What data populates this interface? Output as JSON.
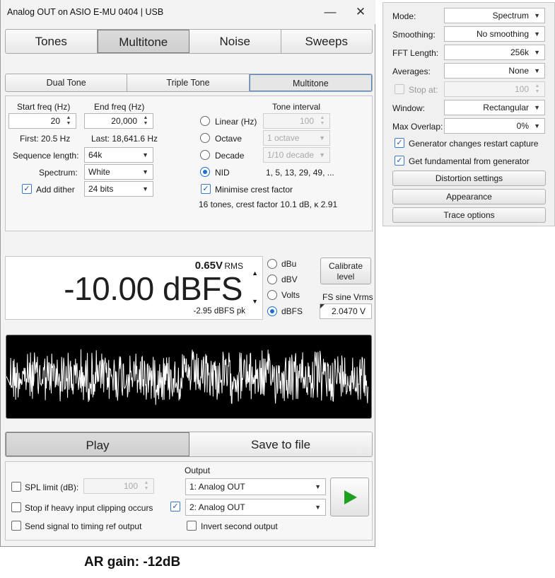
{
  "window": {
    "title": "Analog OUT on ASIO E-MU 0404 | USB",
    "minimize": "—",
    "close": "✕"
  },
  "main_tabs": [
    "Tones",
    "Multitone",
    "Noise",
    "Sweeps"
  ],
  "main_tab_selected": "Multitone",
  "sub_tabs": [
    "Dual Tone",
    "Triple Tone",
    "Multitone"
  ],
  "sub_tab_selected": "Multitone",
  "multitone": {
    "start_freq_label": "Start freq (Hz)",
    "start_freq_value": "20",
    "end_freq_label": "End freq (Hz)",
    "end_freq_value": "20,000",
    "first_text": "First: 20.5 Hz",
    "last_text": "Last: 18,641.6 Hz",
    "sequence_length_label": "Sequence length:",
    "sequence_length_value": "64k",
    "spectrum_label": "Spectrum:",
    "spectrum_value": "White",
    "add_dither_label": "Add dither",
    "dither_bits_value": "24 bits",
    "tone_interval_label": "Tone interval",
    "linear_label": "Linear (Hz)",
    "linear_value": "100",
    "octave_label": "Octave",
    "octave_value": "1 octave",
    "decade_label": "Decade",
    "decade_value": "1/10 decade",
    "nid_label": "NID",
    "nid_sequence": "1, 5, 13, 29, 49, ...",
    "minimise_crest_label": "Minimise crest factor",
    "summary": "16 tones, crest factor 10.1 dB, κ 2.91",
    "selected_interval": "NID"
  },
  "level": {
    "rms_value": "0.65V",
    "rms_unit": "RMS",
    "main_value": "-10.00 dBFS",
    "peak_text": "-2.95 dBFS pk",
    "up_arrow": "▲",
    "down_arrow": "▼",
    "units": [
      "dBu",
      "dBV",
      "Volts",
      "dBFS"
    ],
    "selected_unit": "dBFS",
    "calibrate_label": "Calibrate level",
    "fs_sine_label": "FS sine Vrms",
    "fs_sine_value": "2.0470 V"
  },
  "play_tabs": [
    "Play",
    "Save to file"
  ],
  "output": {
    "spl_limit_label": "SPL limit (dB):",
    "spl_limit_value": "100",
    "stop_clipping_label": "Stop if heavy input clipping occurs",
    "send_timing_label": "Send signal to timing ref output",
    "output_label": "Output",
    "output1_value": "1: Analog OUT",
    "output2_value": "2: Analog OUT",
    "invert_label": "Invert second output",
    "play_icon": "play-icon",
    "play_color": "#1ea01e"
  },
  "footer_note": "AR gain: -12dB",
  "analyzer_panel": {
    "mode_label": "Mode:",
    "mode_value": "Spectrum",
    "smoothing_label": "Smoothing:",
    "smoothing_value": "No smoothing",
    "fft_label": "FFT Length:",
    "fft_value": "256k",
    "averages_label": "Averages:",
    "averages_value": "None",
    "stop_at_label": "Stop at:",
    "stop_at_value": "100",
    "window_label": "Window:",
    "window_value": "Rectangular",
    "max_overlap_label": "Max Overlap:",
    "max_overlap_value": "0%",
    "gen_restart_label": "Generator changes restart capture",
    "get_fundamental_label": "Get fundamental from generator",
    "distortion_button": "Distortion settings",
    "appearance_button": "Appearance",
    "trace_button": "Trace options"
  },
  "colors": {
    "accent": "#1e6fd0",
    "waveform_bg": "#000000",
    "waveform_fg": "#ffffff"
  }
}
